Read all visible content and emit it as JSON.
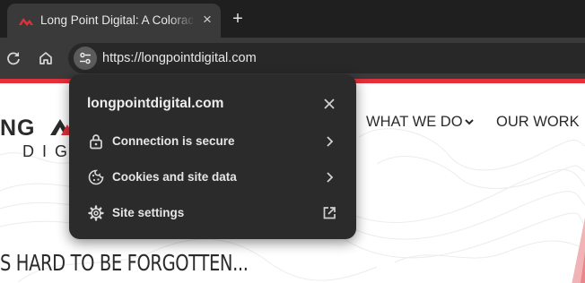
{
  "browser": {
    "tab": {
      "title": "Long Point Digital: A Colorado",
      "close_icon": "close-icon",
      "favicon": "long-point-digital-favicon"
    },
    "new_tab_symbol": "+",
    "toolbar": {
      "reload_icon": "reload-icon",
      "home_icon": "home-icon",
      "site_info_icon": "tune-icon",
      "url": "https://longpointdigital.com"
    }
  },
  "site_info_popup": {
    "domain": "longpointdigital.com",
    "rows": [
      {
        "label": "Connection is secure",
        "icon": "lock-icon",
        "trailing_icon": "chevron-right-icon"
      },
      {
        "label": "Cookies and site data",
        "icon": "cookie-icon",
        "trailing_icon": "chevron-right-icon"
      },
      {
        "label": "Site settings",
        "icon": "gear-icon",
        "trailing_icon": "open-in-new-icon"
      }
    ]
  },
  "page": {
    "logo_top": "NG",
    "logo_bottom": "DIG",
    "nav": [
      {
        "label": "WHAT WE DO",
        "has_dropdown": true
      },
      {
        "label": "OUR WORK"
      }
    ],
    "hero_text": "S HARD TO BE FORGOTTEN..."
  },
  "colors": {
    "brand_red": "#e3303a",
    "popup_bg": "#2b2b2b",
    "toolbar_bg": "#3a3a3a",
    "tabstrip_bg": "#1f1f1f"
  }
}
